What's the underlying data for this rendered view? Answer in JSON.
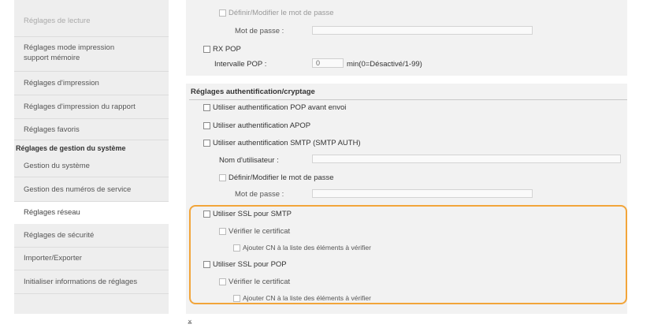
{
  "sidebar": {
    "items": [
      {
        "label": "Réglages de lecture"
      },
      {
        "label": "Réglages mode impression support mémoire"
      },
      {
        "label": "Réglages d'impression"
      },
      {
        "label": "Réglages d'impression du rapport"
      },
      {
        "label": "Réglages favoris"
      },
      {
        "label": "Réglages de gestion du système"
      },
      {
        "label": "Gestion du système"
      },
      {
        "label": "Gestion des numéros de service"
      },
      {
        "label": "Réglages réseau"
      },
      {
        "label": "Réglages de sécurité"
      },
      {
        "label": "Importer/Exporter"
      },
      {
        "label": "Initialiser informations de réglages"
      }
    ]
  },
  "pop_panel": {
    "define_password_label": "Définir/Modifier le mot de passe",
    "password_label": "Mot de passe :",
    "rx_pop_label": "RX POP",
    "pop_interval_label": "Intervalle POP :",
    "pop_interval_value": "0",
    "pop_interval_unit": "min(0=Désactivé/1-99)"
  },
  "auth_panel": {
    "title": "Réglages authentification/cryptage",
    "pop_before_send": "Utiliser authentification POP avant envoi",
    "apop": "Utiliser authentification APOP",
    "smtp_auth": "Utiliser authentification SMTP (SMTP AUTH)",
    "username_label": "Nom d'utilisateur :",
    "define_password_label": "Définir/Modifier le mot de passe",
    "password_label": "Mot de passe :",
    "ssl_smtp": "Utiliser SSL pour SMTP",
    "verify_cert_smtp": "Vérifier le certificat",
    "add_cn_smtp": "Ajouter CN à la liste des éléments à vérifier",
    "ssl_pop": "Utiliser SSL pour POP",
    "verify_cert_pop": "Vérifier le certificat",
    "add_cn_pop": "Ajouter CN à la liste des éléments à vérifier"
  },
  "colors": {
    "highlight": "#f2a53a",
    "sidebar_bg": "#eeeeee",
    "panel_bg": "#f2f2f2"
  }
}
